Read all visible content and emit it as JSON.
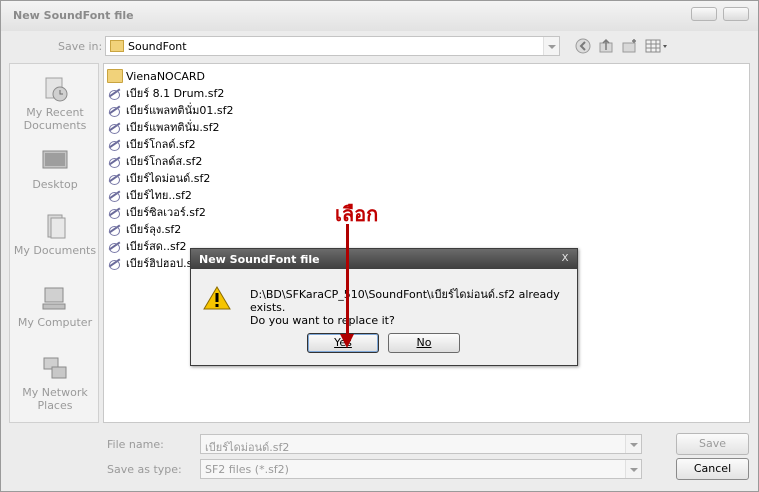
{
  "window": {
    "title": "New SoundFont file"
  },
  "save_in": {
    "label": "Save in:",
    "value": "SoundFont"
  },
  "places": [
    {
      "label": "My Recent Documents",
      "icon": "recent-documents-icon"
    },
    {
      "label": "Desktop",
      "icon": "desktop-icon"
    },
    {
      "label": "My Documents",
      "icon": "my-documents-icon"
    },
    {
      "label": "My Computer",
      "icon": "my-computer-icon"
    },
    {
      "label": "My Network Places",
      "icon": "network-places-icon"
    }
  ],
  "files": [
    {
      "name": "VienaNOCARD",
      "type": "folder"
    },
    {
      "name": "เบียร์ 8.1 Drum.sf2",
      "type": "sf2"
    },
    {
      "name": "เบียร์แพลทตินั่ม01.sf2",
      "type": "sf2"
    },
    {
      "name": "เบียร์แพลทตินั่ม.sf2",
      "type": "sf2"
    },
    {
      "name": "เบียร์โกลด์.sf2",
      "type": "sf2"
    },
    {
      "name": "เบียร์โกลด์ส.sf2",
      "type": "sf2"
    },
    {
      "name": "เบียร์ไดม่อนด์.sf2",
      "type": "sf2"
    },
    {
      "name": "เบียร์ไทย..sf2",
      "type": "sf2"
    },
    {
      "name": "เบียร์ซิลเวอร์.sf2",
      "type": "sf2"
    },
    {
      "name": "เบียร์ลุง.sf2",
      "type": "sf2"
    },
    {
      "name": "เบียร์สด..sf2",
      "type": "sf2"
    },
    {
      "name": "เบียร์ฮิปฮอป.s",
      "type": "sf2"
    }
  ],
  "file_name": {
    "label": "File name:",
    "value": "เบียร์ไดม่อนด์.sf2"
  },
  "save_as_type": {
    "label": "Save as type:",
    "value": "SF2 files (*.sf2)"
  },
  "buttons": {
    "save": "Save",
    "cancel": "Cancel"
  },
  "dialog": {
    "title": "New SoundFont file",
    "close": "X",
    "message_line1": "D:\\BD\\SFKaraCP_510\\SoundFont\\เบียร์ไดม่อนด์.sf2 already exists.",
    "message_line2": "Do you want to replace it?",
    "yes": "Yes",
    "no": "No"
  },
  "annotation": {
    "text": "เลือก",
    "color": "#c00000"
  }
}
